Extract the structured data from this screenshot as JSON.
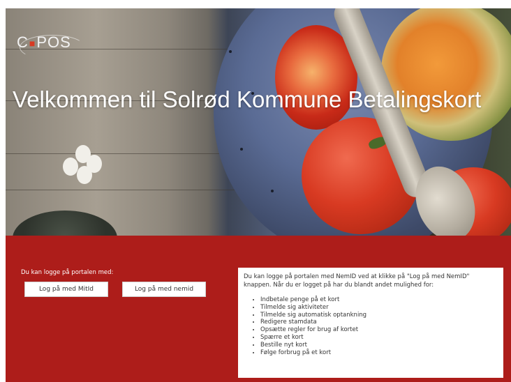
{
  "hero": {
    "logo_text_c": "C",
    "logo_text_pos": "POS",
    "title": "Velkommen til Solrød Kommune Betalingskort"
  },
  "login": {
    "prompt": "Du kan logge på portalen med:",
    "mitid_button": "Log på med MitId",
    "nemid_button": "Log på med nemid"
  },
  "info": {
    "intro": "Du kan logge på portalen med NemID ved at klikke på \"Log på med NemID\" knappen. Når du er logget på har du blandt andet mulighed for:",
    "items": [
      "Indbetale penge på et kort",
      "Tilmelde sig aktiviteter",
      "Tilmelde sig automatisk optankning",
      "Redigere stamdata",
      "Opsætte regler for brug af kortet",
      "Spærre et kort",
      "Bestille nyt kort",
      "Følge forbrug på et kort"
    ]
  },
  "colors": {
    "panel_red": "#ad1d1a",
    "white": "#ffffff"
  }
}
